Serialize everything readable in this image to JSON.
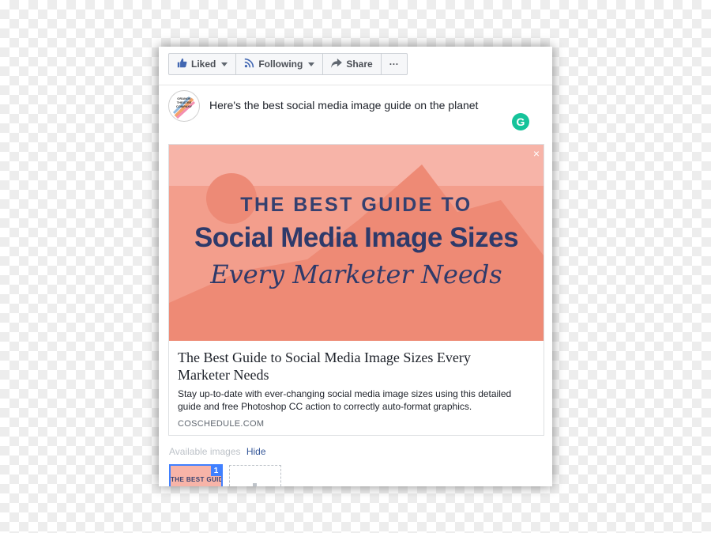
{
  "actions": {
    "liked_label": "Liked",
    "following_label": "Following",
    "share_label": "Share",
    "more_label": "···"
  },
  "post": {
    "text": "Here's the best social media image guide on the planet",
    "avatar_text": "ORANGE THEATRE COMPANY",
    "grammarly_glyph": "G"
  },
  "preview": {
    "close_glyph": "×",
    "hero_line1": "THE BEST GUIDE TO",
    "hero_line2": "Social Media Image Sizes",
    "hero_line3": "Every Marketer Needs",
    "title": "The Best Guide to Social Media Image Sizes Every Marketer Needs",
    "description": "Stay up-to-date with ever-changing social media image sizes using this detailed guide and free Photoshop CC action to correctly auto-format graphics.",
    "domain": "COSCHEDULE.COM"
  },
  "images": {
    "label": "Available images",
    "hide_label": "Hide",
    "thumb_text": "THE BEST GUIDE TO",
    "thumb_count": "1"
  },
  "colors": {
    "facebook_blue": "#4267b2",
    "link_blue": "#365899",
    "hero_bg": "#f7b4a8",
    "hero_text": "#2e3a6a",
    "grammarly_green": "#15c39a",
    "selected_border": "#4080ff"
  },
  "icons": [
    "thumbs-up-icon",
    "caret-down-icon",
    "rss-icon",
    "share-arrow-icon",
    "ellipsis-icon",
    "close-icon",
    "grammarly-icon"
  ]
}
